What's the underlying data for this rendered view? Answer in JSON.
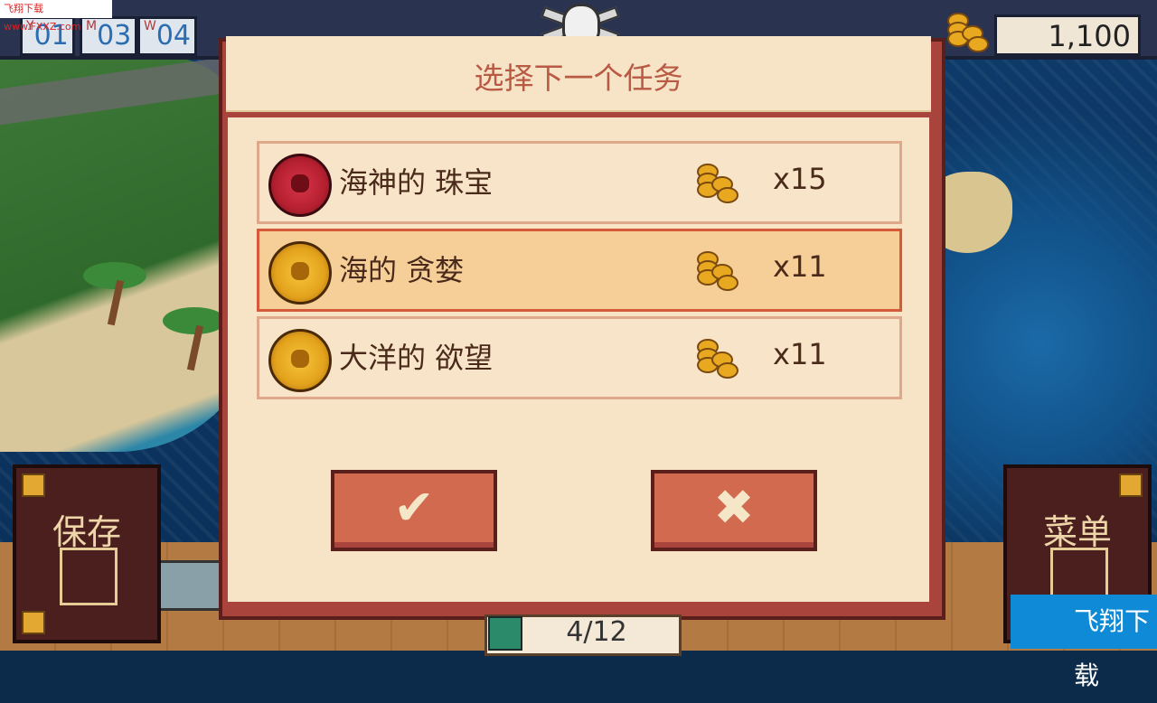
{
  "watermark": {
    "top_left": "飞翔下载 www.FXXZ.com",
    "bottom_right": "飞翔下载"
  },
  "date": {
    "year_letter": "Y",
    "year": "01",
    "month_letter": "M",
    "month": "03",
    "week_letter": "W",
    "week": "04"
  },
  "gold": {
    "value": "1,100",
    "icon": "coin-stack-icon"
  },
  "dialog": {
    "title": "选择下一个任务",
    "missions": [
      {
        "name": "海神的 珠宝",
        "reward": "x15",
        "coin_color": "red",
        "selected": false
      },
      {
        "name": "海的 贪婪",
        "reward": "x11",
        "coin_color": "gold",
        "selected": true
      },
      {
        "name": "大洋的 欲望",
        "reward": "x11",
        "coin_color": "gold",
        "selected": false
      }
    ],
    "confirm_icon": "check-icon",
    "cancel_icon": "cross-icon"
  },
  "left_book": {
    "label": "保存",
    "icon": "floppy-disk-icon"
  },
  "right_book": {
    "label": "菜单",
    "icon": "document-icon"
  },
  "counter": {
    "text": "4/12",
    "icon": "crown-icon"
  },
  "colors": {
    "dialog_frame": "#a8443c",
    "parchment": "#f7e3c6",
    "selected_row": "#f6cf98",
    "title_text": "#b85a44"
  }
}
